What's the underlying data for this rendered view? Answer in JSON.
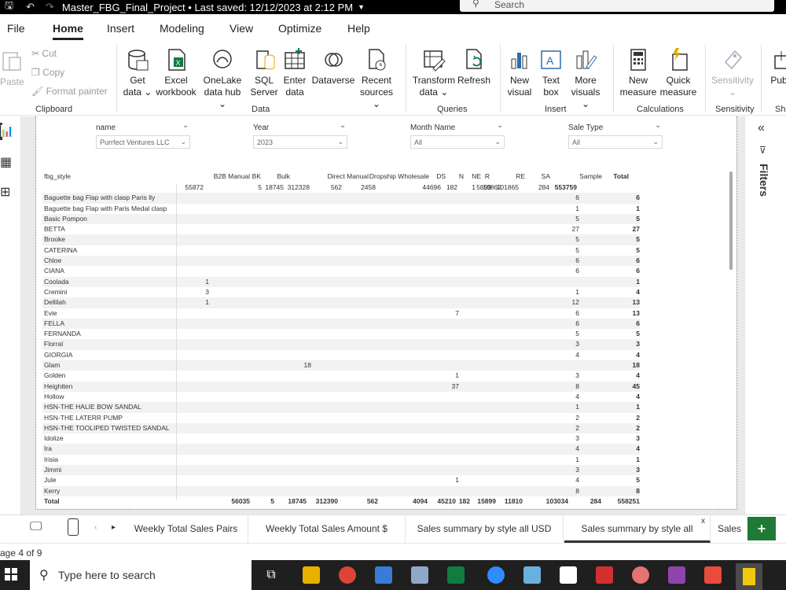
{
  "window": {
    "title": "Master_FBG_Final_Project • Last saved: 12/12/2023 at 2:12 PM",
    "search_placeholder": "Search"
  },
  "menu": [
    "File",
    "Home",
    "Insert",
    "Modeling",
    "View",
    "Optimize",
    "Help"
  ],
  "ribbon": {
    "clipboard": {
      "paste": "Paste",
      "cut": "Cut",
      "copy": "Copy",
      "format_painter": "Format painter",
      "label": "Clipboard"
    },
    "data": {
      "get_data": [
        "Get",
        "data ⌄"
      ],
      "excel": [
        "Excel",
        "workbook"
      ],
      "onelake": [
        "OneLake",
        "data hub ⌄"
      ],
      "sql": [
        "SQL",
        "Server"
      ],
      "enter": [
        "Enter",
        "data"
      ],
      "dataverse": [
        "Dataverse",
        ""
      ],
      "recent": [
        "Recent",
        "sources ⌄"
      ],
      "label": "Data"
    },
    "queries": {
      "transform": [
        "Transform",
        "data ⌄"
      ],
      "refresh": [
        "Refresh",
        ""
      ],
      "label": "Queries"
    },
    "insert": {
      "new_visual": [
        "New",
        "visual"
      ],
      "text_box": [
        "Text",
        "box"
      ],
      "more_visuals": [
        "More",
        "visuals ⌄"
      ],
      "label": "Insert"
    },
    "calculations": {
      "new_measure": [
        "New",
        "measure"
      ],
      "quick_measure": [
        "Quick",
        "measure"
      ],
      "label": "Calculations"
    },
    "sensitivity": {
      "btn": [
        "Sensitivity",
        "⌄"
      ],
      "label": "Sensitivity"
    },
    "share": {
      "btn": "Pub",
      "label": "Sha"
    }
  },
  "slicers": [
    {
      "label": "name",
      "value": "Purrfect Ventures LLC"
    },
    {
      "label": "Year",
      "value": "2023"
    },
    {
      "label": "Month Name",
      "value": "All"
    },
    {
      "label": "Sale Type",
      "value": "All"
    }
  ],
  "matrix": {
    "row_header": "fbg_style",
    "columns": [
      "B2B Manual",
      "BK",
      "Bulk",
      "Direct Manual",
      "Dropship Wholesale",
      "DS",
      "N",
      "NE",
      "R",
      "RE",
      "SA",
      "Sample",
      "Total"
    ],
    "first_row": [
      "55872",
      "5",
      "18745",
      "312328",
      "562",
      "2458",
      "44696",
      "182",
      "1",
      "5899",
      "10862",
      "101865",
      "284",
      "553759"
    ],
    "rows": [
      {
        "name": "Baguette bag Flap with clasp Paris lly",
        "sa": "6",
        "total": "6"
      },
      {
        "name": "Baguette bag Flap with Paris Medal clasp",
        "sa": "1",
        "total": "1"
      },
      {
        "name": "Basic Pompon",
        "sa": "5",
        "total": "5"
      },
      {
        "name": "BETTA",
        "sa": "27",
        "total": "27"
      },
      {
        "name": "Brooke",
        "sa": "5",
        "total": "5"
      },
      {
        "name": "CATERINA",
        "sa": "5",
        "total": "5"
      },
      {
        "name": "Chloe",
        "sa": "6",
        "total": "6"
      },
      {
        "name": "CIANA",
        "sa": "6",
        "total": "6"
      },
      {
        "name": "Coolada",
        "b2b": "1",
        "total": "1"
      },
      {
        "name": "Cremini",
        "b2b": "3",
        "sa": "1",
        "total": "4"
      },
      {
        "name": "Dellilah",
        "b2b": "1",
        "sa": "12",
        "total": "13"
      },
      {
        "name": "Evie",
        "ds": "7",
        "sa": "6",
        "total": "13"
      },
      {
        "name": "FELLA",
        "sa": "6",
        "total": "6"
      },
      {
        "name": "FERNANDA",
        "sa": "5",
        "total": "5"
      },
      {
        "name": "Florral",
        "sa": "3",
        "total": "3"
      },
      {
        "name": "GIORGIA",
        "sa": "4",
        "total": "4"
      },
      {
        "name": "Glam",
        "bulk": "18",
        "total": "18"
      },
      {
        "name": "Golden",
        "ds": "1",
        "sa": "3",
        "total": "4"
      },
      {
        "name": "Heightten",
        "ds": "37",
        "sa": "8",
        "total": "45"
      },
      {
        "name": "Hollow",
        "sa": "4",
        "total": "4"
      },
      {
        "name": "HSN-THE HALIE BOW SANDAL",
        "sa": "1",
        "total": "1"
      },
      {
        "name": "HSN-THE LATERR PUMP",
        "sa": "2",
        "total": "2"
      },
      {
        "name": "HSN-THE TOOLIPED TWISTED SANDAL",
        "sa": "2",
        "total": "2"
      },
      {
        "name": "Idolize",
        "sa": "3",
        "total": "3"
      },
      {
        "name": "Ira",
        "sa": "4",
        "total": "4"
      },
      {
        "name": "Irisia",
        "sa": "1",
        "total": "1"
      },
      {
        "name": "Jimmi",
        "sa": "3",
        "total": "3"
      },
      {
        "name": "Jule",
        "ds": "1",
        "sa": "4",
        "total": "5"
      },
      {
        "name": "Kerry",
        "sa": "8",
        "total": "8"
      }
    ],
    "total_row": [
      "Total",
      "56035",
      "5",
      "18745",
      "312390",
      "562",
      "4094",
      "45210",
      "182",
      "1",
      "5899",
      "11810",
      "103034",
      "284",
      "558251"
    ]
  },
  "filters_label": "Filters",
  "tabs": [
    "Weekly Total Sales Pairs",
    "Weekly Total Sales Amount $",
    "Sales summary by style all USD",
    "Sales summary by style all",
    "Sales"
  ],
  "tab_close": "x",
  "add_tab": "+",
  "status": "age 4 of 9",
  "taskbar": {
    "search_placeholder": "Type here to search"
  }
}
